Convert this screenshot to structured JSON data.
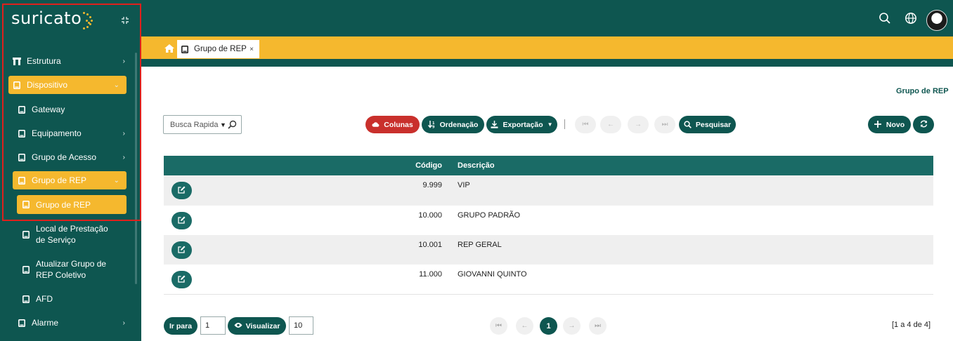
{
  "brand": {
    "logo_text": "suricato"
  },
  "colors": {
    "primary": "#0e5650",
    "accent": "#f5b82e",
    "danger": "#c9302c",
    "table_header": "#1a6b66"
  },
  "sidebar": {
    "items": [
      {
        "label": "Estrutura",
        "icon": "building-icon",
        "chevron": "›"
      },
      {
        "label": "Dispositivo",
        "icon": "device-icon",
        "chevron": "⌄"
      },
      {
        "label": "Gateway",
        "icon": "device-icon"
      },
      {
        "label": "Equipamento",
        "icon": "device-icon",
        "chevron": "›"
      },
      {
        "label": "Grupo de Acesso",
        "icon": "device-icon",
        "chevron": "›"
      },
      {
        "label": "Grupo de REP",
        "icon": "device-icon",
        "chevron": "⌄"
      },
      {
        "label": "Grupo de REP",
        "icon": "device-icon"
      },
      {
        "label_line1": "Local de Prestação",
        "label_line2": "de Serviço",
        "icon": "device-icon"
      },
      {
        "label_line1": "Atualizar Grupo de",
        "label_line2": "REP Coletivo",
        "icon": "device-icon"
      },
      {
        "label": "AFD",
        "icon": "device-icon"
      },
      {
        "label": "Alarme",
        "icon": "device-icon",
        "chevron": "›"
      }
    ]
  },
  "tabs": [
    {
      "label": "Grupo de REP",
      "close": "×"
    }
  ],
  "page": {
    "title": "Grupo de REP"
  },
  "toolbar": {
    "search_placeholder": "Busca Rapida",
    "colunas": "Colunas",
    "ordenacao": "Ordenação",
    "exportacao": "Exportação",
    "pesquisar": "Pesquisar",
    "novo": "Novo"
  },
  "table": {
    "columns": [
      "Código",
      "Descrição"
    ],
    "rows": [
      {
        "code": "9.999",
        "desc": "VIP"
      },
      {
        "code": "10.000",
        "desc": "GRUPO PADRÃO"
      },
      {
        "code": "10.001",
        "desc": "REP GERAL"
      },
      {
        "code": "11.000",
        "desc": "GIOVANNI QUINTO"
      }
    ]
  },
  "footer": {
    "ir_para": "Ir para",
    "page_value": "1",
    "visualizar": "Visualizar",
    "page_size": "10",
    "current_page": "1",
    "count": "[1 a 4 de 4]"
  }
}
